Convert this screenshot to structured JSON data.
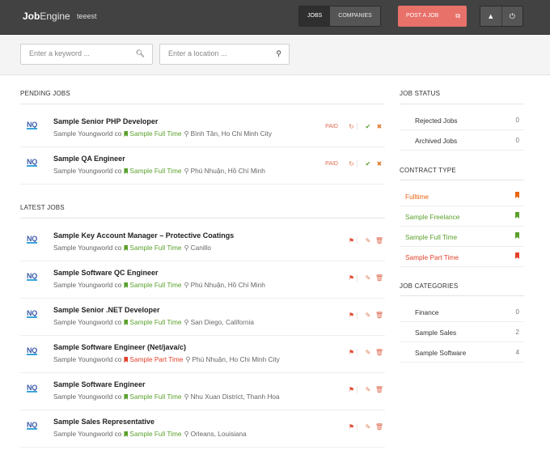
{
  "header": {
    "brand_bold": "Job",
    "brand_light": "Engine",
    "username": "teeest",
    "nav": [
      {
        "label": "JOBS"
      },
      {
        "label": "COMPANIES"
      }
    ],
    "post_label": "POST A JOB",
    "icons": [
      "user-icon",
      "power-icon"
    ]
  },
  "search": {
    "keyword_placeholder": "Enter a keyword ...",
    "location_placeholder": "Enter a location ..."
  },
  "pending": {
    "title": "PENDING JOBS",
    "jobs": [
      {
        "logo": "NQ",
        "title": "Sample Senior PHP Developer",
        "company": "Sample Youngworld co",
        "type": "Sample Full Time",
        "type_color": "green",
        "location": "Bình Tân, Ho Chi Minh City",
        "badge": "PAID"
      },
      {
        "logo": "NQ",
        "title": "Sample QA Engineer",
        "company": "Sample Youngworld co",
        "type": "Sample Full Time",
        "type_color": "green",
        "location": "Phú Nhuận, Hồ Chí Minh",
        "badge": "PAID"
      }
    ]
  },
  "latest": {
    "title": "LATEST JOBS",
    "jobs": [
      {
        "logo": "NQ",
        "title": "Sample Key Account Manager – Protective Coatings",
        "company": "Sample Youngworld co",
        "type": "Sample Full Time",
        "type_color": "green",
        "location": "Canillo"
      },
      {
        "logo": "NQ",
        "title": "Sample Software QC Engineer",
        "company": "Sample Youngworld co",
        "type": "Sample Full Time",
        "type_color": "green",
        "location": "Phú Nhuận, Hồ Chí Minh"
      },
      {
        "logo": "NQ",
        "title": "Sample Senior .NET Developer",
        "company": "Sample Youngworld co",
        "type": "Sample Full Time",
        "type_color": "green",
        "location": "San Diego, California"
      },
      {
        "logo": "NQ",
        "title": "Sample Software Engineer (Net/java/c)",
        "company": "Sample Youngworld co",
        "type": "Sample Part Time",
        "type_color": "red",
        "location": "Phú Nhuận, Ho Chi Minh City"
      },
      {
        "logo": "NQ",
        "title": "Sample Software Engineer",
        "company": "Sample Youngworld co",
        "type": "Sample Full Time",
        "type_color": "green",
        "location": "Nhu Xuan District, Thanh Hoa"
      },
      {
        "logo": "NQ",
        "title": "Sample Sales Representative",
        "company": "Sample Youngworld co",
        "type": "Sample Full Time",
        "type_color": "green",
        "location": "Orleans, Louisiana"
      }
    ]
  },
  "sidebar": {
    "job_status": {
      "title": "JOB STATUS",
      "items": [
        {
          "label": "Rejected Jobs",
          "count": "0"
        },
        {
          "label": "Archived Jobs",
          "count": "0"
        }
      ]
    },
    "contract_type": {
      "title": "CONTRACT TYPE",
      "items": [
        {
          "label": "Fulltime",
          "color": "#e8650f"
        },
        {
          "label": "Sample Freelance",
          "color": "#5aa02c"
        },
        {
          "label": "Sample Full Time",
          "color": "#5aa02c"
        },
        {
          "label": "Sample Part Time",
          "color": "#e2402b"
        }
      ]
    },
    "job_categories": {
      "title": "JOB CATEGORIES",
      "items": [
        {
          "label": "Finance",
          "count": "0"
        },
        {
          "label": "Sample Sales",
          "count": "2"
        },
        {
          "label": "Sample Software",
          "count": "4"
        }
      ]
    }
  },
  "colors": {
    "accent": "#e8716a",
    "green": "#5aa02c",
    "red": "#e2402b",
    "header": "#424242"
  }
}
